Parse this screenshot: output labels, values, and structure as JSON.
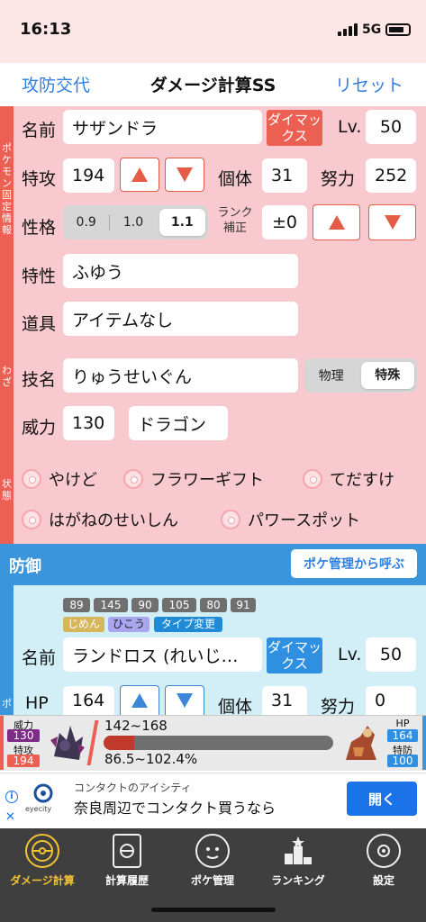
{
  "status": {
    "time": "16:13",
    "network": "5G"
  },
  "nav": {
    "left": "攻防交代",
    "title": "ダメージ計算SS",
    "right": "リセット"
  },
  "attack": {
    "side_labels": {
      "info": "ポケモン固定情報",
      "move": "わざ",
      "state": "状態"
    },
    "name_label": "名前",
    "name_value": "サザンドラ",
    "dynamax": "ダイマックス",
    "lv_label": "Lv.",
    "lv_value": "50",
    "stat_label": "特攻",
    "stat_value": "194",
    "iv_label": "個体",
    "iv_value": "31",
    "ev_label": "努力",
    "ev_value": "252",
    "nature_label": "性格",
    "nature_options": [
      "0.9",
      "1.0",
      "1.1"
    ],
    "nature_selected": "1.1",
    "rank_label": "ランク補正",
    "rank_value": "±0",
    "ability_label": "特性",
    "ability_value": "ふゆう",
    "item_label": "道具",
    "item_value": "アイテムなし",
    "move_label": "技名",
    "move_value": "りゅうせいぐん",
    "category_options": [
      "物理",
      "特殊"
    ],
    "category_selected": "特殊",
    "power_label": "威力",
    "power_value": "130",
    "type_value": "ドラゴン",
    "states": [
      "やけど",
      "フラワーギフト",
      "てだすけ",
      "はがねのせいしん",
      "パワースポット"
    ]
  },
  "defense": {
    "title": "防御",
    "call_button": "ポケ管理から呼ぶ",
    "base_stats": [
      "89",
      "145",
      "90",
      "105",
      "80",
      "91"
    ],
    "tags": [
      "じめん",
      "ひこう",
      "タイプ変更"
    ],
    "name_label": "名前",
    "name_value": "ランドロス (れいじ…",
    "dynamax": "ダイマックス",
    "lv_label": "Lv.",
    "lv_value": "50",
    "hp_label": "HP",
    "hp_value": "164",
    "iv_label": "個体",
    "iv_value": "31",
    "ev_label": "努力",
    "ev_value": "0",
    "side_label": "ポ"
  },
  "result": {
    "power_label": "威力",
    "power_value": "130",
    "spatk_label": "特攻",
    "spatk_value": "194",
    "damage_range": "142~168",
    "percent_range": "86.5~102.4%",
    "hp_label": "HP",
    "hp_value": "164",
    "spdef_label": "特防",
    "spdef_value": "100",
    "remaining_hp_fraction": 0.135
  },
  "ad": {
    "brand": "eyecity",
    "line1": "コンタクトのアイシティ",
    "line2": "奈良周辺でコンタクト買うなら",
    "button": "開く"
  },
  "tabs": [
    {
      "label": "ダメージ計算",
      "icon": "calculator-pokeball-icon",
      "active": true
    },
    {
      "label": "計算履歴",
      "icon": "history-icon",
      "active": false
    },
    {
      "label": "ポケ管理",
      "icon": "pokemon-manage-icon",
      "active": false
    },
    {
      "label": "ランキング",
      "icon": "ranking-icon",
      "active": false
    },
    {
      "label": "設定",
      "icon": "settings-icon",
      "active": false
    }
  ],
  "colors": {
    "attack_bg": "#f8c9cf",
    "attack_accent": "#ec5f53",
    "defense_accent": "#3b95dc",
    "defense_bg": "#d2eff7",
    "link": "#2f7fe0"
  }
}
